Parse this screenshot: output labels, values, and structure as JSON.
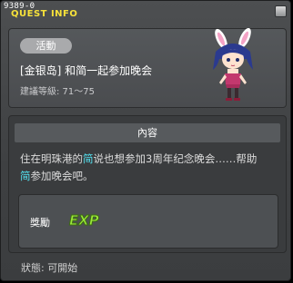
{
  "window": {
    "quest_id": "9389-0",
    "title": "QUEST INFO"
  },
  "quest": {
    "tag": "活動",
    "name": "[金银岛] 和简一起参加晚会",
    "level": "建議等級: 71～75"
  },
  "content": {
    "header": "內容",
    "desc_part1": "住在明珠港的",
    "desc_hl1": "简",
    "desc_part2": "说也想参加3周年纪念晚会……帮助",
    "desc_hl2": "简",
    "desc_part3": "参加晚会吧。"
  },
  "reward": {
    "label": "獎勵",
    "exp_text": "EXP"
  },
  "status": {
    "text": "狀態:  可開始"
  },
  "colors": {
    "title": "#f7e23a",
    "highlight": "#53e3f2",
    "exp": "#9be83a"
  },
  "icons": {
    "close": "close-icon",
    "character": "bunny-girl-npc-sprite",
    "exp": "exp-icon"
  }
}
